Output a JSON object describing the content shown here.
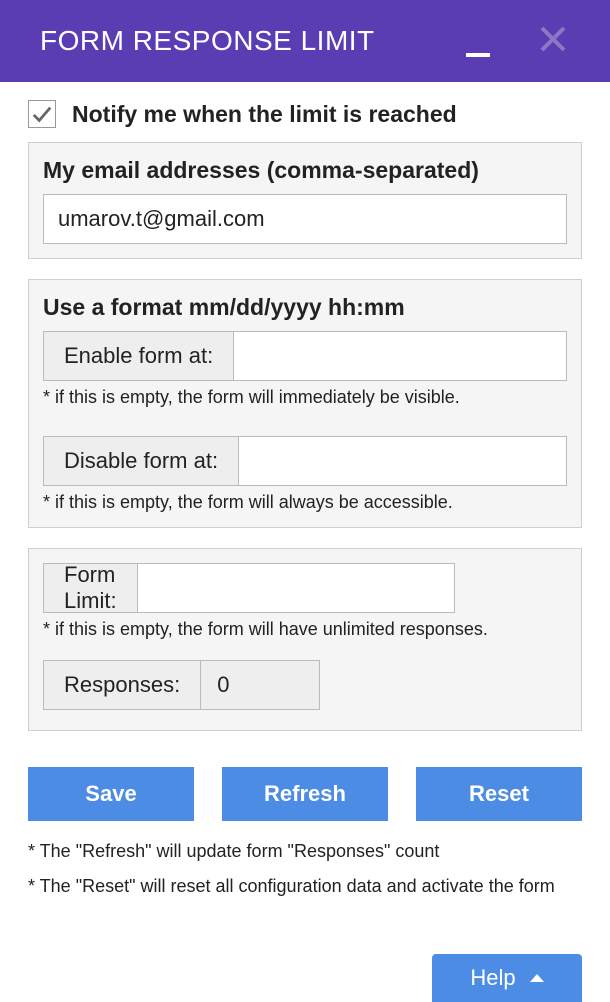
{
  "header": {
    "title": "FORM RESPONSE LIMIT"
  },
  "notify": {
    "label": "Notify me when the limit is reached",
    "checked": true
  },
  "email": {
    "label": "My email addresses (comma-separated)",
    "value": "umarov.t@gmail.com"
  },
  "schedule": {
    "format_label": "Use a format mm/dd/yyyy hh:mm",
    "enable_label": "Enable form at:",
    "enable_value": "",
    "enable_hint": "* if this is empty, the form will immediately be visible.",
    "disable_label": "Disable form at:",
    "disable_value": "",
    "disable_hint": "* if this is empty, the form will always be accessible."
  },
  "limit": {
    "label": "Form Limit:",
    "value": "",
    "hint": "* if this is empty, the form will have unlimited responses.",
    "responses_label": "Responses:",
    "responses_value": "0"
  },
  "buttons": {
    "save": "Save",
    "refresh": "Refresh",
    "reset": "Reset",
    "help": "Help"
  },
  "footnotes": {
    "refresh": "* The \"Refresh\" will update form \"Responses\" count",
    "reset": "* The \"Reset\" will reset all configuration data and activate the form"
  }
}
